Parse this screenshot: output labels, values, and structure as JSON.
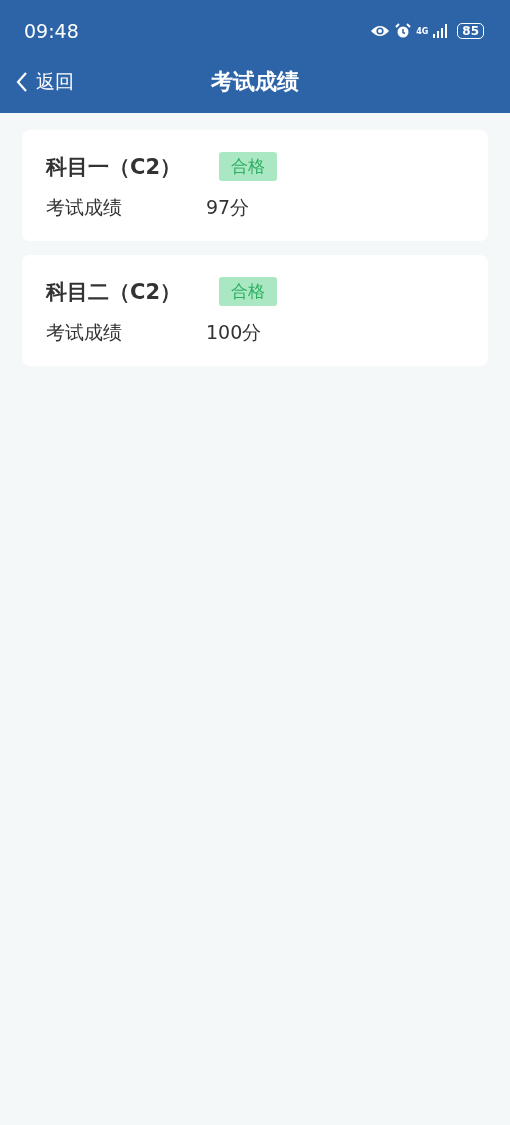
{
  "status_bar": {
    "time": "09:48",
    "network": "4G",
    "battery": "85"
  },
  "nav": {
    "back": "返回",
    "title": "考试成绩"
  },
  "results": [
    {
      "subject": "科目一（C2）",
      "badge": {
        "text": "合格",
        "kind": "pass"
      },
      "label": "考试成绩",
      "score": "97分"
    },
    {
      "subject": "科目二（C2）",
      "badge": {
        "text": "合格",
        "kind": "pass"
      },
      "label": "考试成绩",
      "score": "100分"
    }
  ]
}
